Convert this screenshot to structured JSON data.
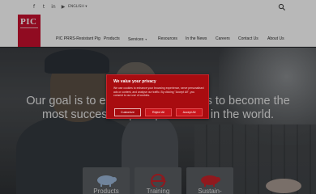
{
  "topbar": {
    "social": [
      {
        "icon": "facebook-icon",
        "glyph": "f"
      },
      {
        "icon": "twitter-icon",
        "glyph": "t"
      },
      {
        "icon": "linkedin-icon",
        "glyph": "in"
      },
      {
        "icon": "youtube-icon",
        "glyph": "▶"
      }
    ],
    "language": "ENGLISH ▾",
    "search_icon": "search-icon"
  },
  "brand": {
    "logo_text": "PIC",
    "color": "#c8102e"
  },
  "nav": {
    "items": [
      {
        "label": "PIC PRRS-Resistant Pig",
        "dropdown": false
      },
      {
        "label": "Products",
        "dropdown": false
      },
      {
        "label": "Services",
        "dropdown": true
      },
      {
        "label": "Resources",
        "dropdown": false
      },
      {
        "label": "In the News",
        "dropdown": false
      },
      {
        "label": "Careers",
        "dropdown": false
      },
      {
        "label": "Contact Us",
        "dropdown": false
      },
      {
        "label": "About Us",
        "dropdown": false
      }
    ]
  },
  "hero": {
    "headline_line1": "Our goal is to enable our customers to become the",
    "headline_line2": "most successful pork producers in the world."
  },
  "tiles": [
    {
      "label": "Products",
      "icon": "pig-icon"
    },
    {
      "label": "Training\nTools",
      "icon": "training-icon"
    },
    {
      "label": "Sustain-\nability",
      "icon": "sustainability-pig-icon"
    }
  ],
  "cookie_modal": {
    "title": "We value your privacy",
    "body": "We use cookies to enhance your browsing experience, serve personalised ads or content, and analyse our traffic. By clicking \"Accept All\", you consent to our use of cookies.",
    "buttons": {
      "customize": "Customize",
      "reject": "Reject All",
      "accept": "Accept All"
    },
    "colors": {
      "background": "#a80c10",
      "button": "#c9151b"
    }
  }
}
